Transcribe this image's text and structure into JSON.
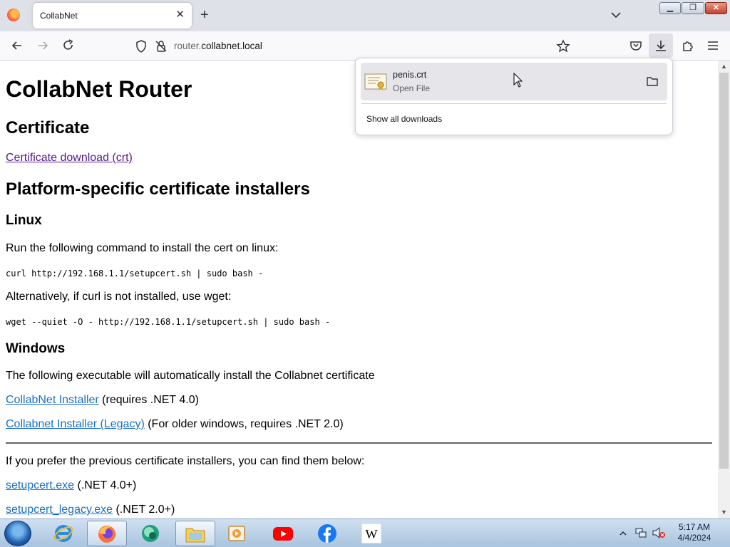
{
  "browser": {
    "tab_title": "CollabNet",
    "url_prefix": "router.",
    "url_domain": "collabnet.local"
  },
  "downloads": {
    "file_name": "penis.crt",
    "file_status": "Open File",
    "show_all": "Show all downloads"
  },
  "page": {
    "title": "CollabNet Router",
    "cert_heading": "Certificate",
    "cert_link": "Certificate download (crt)",
    "installers_heading": "Platform-specific certificate installers",
    "linux_heading": "Linux",
    "linux_intro": "Run the following command to install the cert on linux:",
    "linux_cmd_curl": "curl http://192.168.1.1/setupcert.sh | sudo bash -",
    "linux_alt": "Alternatively, if curl is not installed, use wget:",
    "linux_cmd_wget": "wget --quiet -O - http://192.168.1.1/setupcert.sh | sudo bash -",
    "windows_heading": "Windows",
    "windows_intro": "The following executable will automatically install the Collabnet certificate",
    "installer_link": "CollabNet Installer",
    "installer_note": " (requires .NET 4.0)",
    "installer_legacy_link": "Collabnet Installer (Legacy)",
    "installer_legacy_note": " (For older windows, requires .NET 2.0)",
    "previous_intro": "If you prefer the previous certificate installers, you can find them below:",
    "setupcert_link": "setupcert.exe",
    "setupcert_note": " (.NET 4.0+)",
    "setupcert_legacy_link": "setupcert_legacy.exe",
    "setupcert_legacy_note": " (.NET 2.0+)"
  },
  "taskbar": {
    "time": "5:17 AM",
    "date": "4/4/2024"
  }
}
